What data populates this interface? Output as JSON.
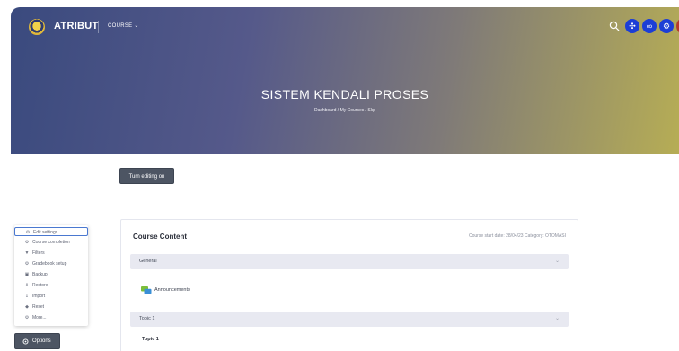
{
  "navbar": {
    "brand": "ATRIBUT",
    "course_menu": "COURSE ⌄",
    "icons": [
      "search-icon",
      "atom-icon",
      "link-icon",
      "gear-icon",
      "avatar"
    ],
    "accent": "#1c3ed6"
  },
  "hero": {
    "title": "SISTEM KENDALI PROSES",
    "breadcrumb": "Dashboard  /  My Courses  /  Skp"
  },
  "edit_button": {
    "label": "Turn editing on"
  },
  "course": {
    "title": "Course Content",
    "meta": "Course start date: 28/04/23   Category: OTOMASI",
    "sections": [
      {
        "label": "General"
      },
      {
        "label": "Topic 1"
      }
    ],
    "activity": "Announcements",
    "topic_heading": "Topic 1"
  },
  "options_menu": {
    "items": [
      {
        "label": "Edit settings",
        "icon": "gear-icon"
      },
      {
        "label": "Course completion",
        "icon": "gear-icon"
      },
      {
        "label": "Filters",
        "icon": "filter-icon"
      },
      {
        "label": "Gradebook setup",
        "icon": "gear-icon"
      },
      {
        "label": "Backup",
        "icon": "backup-icon"
      },
      {
        "label": "Restore",
        "icon": "restore-icon"
      },
      {
        "label": "Import",
        "icon": "import-icon"
      },
      {
        "label": "Reset",
        "icon": "reset-icon"
      },
      {
        "label": "More...",
        "icon": "gear-icon"
      }
    ],
    "button_label": "Options"
  }
}
